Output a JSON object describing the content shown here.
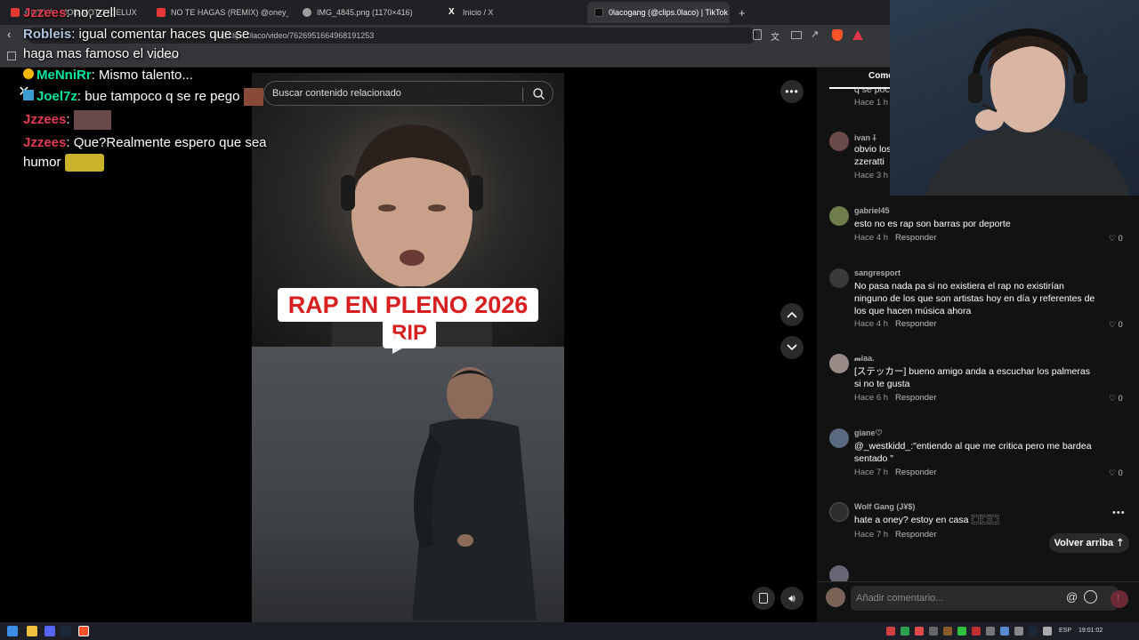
{
  "browser": {
    "tabs": [
      {
        "title": "CIVEVA - MOD MOTO (DELUXE)",
        "color": "#e53935"
      },
      {
        "title": "NO TE HAGAS (REMIX) @oney_fame",
        "color": "#e53935"
      },
      {
        "title": "IMG_4845.png (1170×416)",
        "color": "#9e9e9e"
      },
      {
        "title": "Inicio / X",
        "color": "#ffffff"
      },
      {
        "title": "0lacogang (@clips.0laco) | TikTok",
        "color": "#111111"
      }
    ],
    "new_tab": "+",
    "url": "https://www.tiktok.com/@clips.0laco/video/7626951664968191253",
    "url_visible": "n/@clips.0laco/video/7626951664968191253",
    "bookmark": "ck Stats"
  },
  "chat": [
    {
      "user": "Jzzees",
      "text": ": no, zell",
      "color": "#e53950"
    },
    {
      "user": "Robleis",
      "text": ": igual comentar haces que se haga mas famoso el video",
      "color": "#b0c4de"
    },
    {
      "user": "MeNniRr",
      "text": ": Mismo talento...",
      "color": "#00e6a0"
    },
    {
      "user": "Joel7z",
      "text": ": bue tampoco q se re pego",
      "color": "#00e6a0"
    },
    {
      "user": "Jzzees",
      "text": ":",
      "color": "#e53950"
    },
    {
      "user": "Jzzees",
      "text": ": Que?Realmente espero que sea humor",
      "color": "#e53950"
    }
  ],
  "search": {
    "placeholder": "Buscar contenido relacionado"
  },
  "video": {
    "overlay_title": "RAP EN PLENO 2026",
    "overlay_sub": "RIP"
  },
  "comments_tab": "Come",
  "comments": [
    {
      "user": "",
      "text": "q se pocu",
      "time": "Hace 1 h",
      "reply": "",
      "likes": "",
      "avatar": "#555555"
    },
    {
      "user": "ivan ⸸",
      "text": "obvio los zzeratti",
      "time": "Hace 3 h",
      "reply": "",
      "likes": "",
      "avatar": "#6b4a4a"
    },
    {
      "user": "gabriel45",
      "text": "esto no es rap son barras por deporte",
      "time": "Hace 4 h",
      "reply": "Responder",
      "likes": "0",
      "avatar": "#6e7d4a"
    },
    {
      "user": "sangresport",
      "text": "No pasa nada pa si no existiera el rap no existirían ninguno de los que son artistas hoy en día y referentes de los que hacen música ahora",
      "time": "Hace 4 h",
      "reply": "Responder",
      "likes": "0",
      "avatar": "#3a3a3a"
    },
    {
      "user": "𝓂iaa.",
      "text": "[ステッカー] bueno amigo anda a escuchar los palmeras si no te gusta",
      "time": "Hace 6 h",
      "reply": "Responder",
      "likes": "0",
      "avatar": "#9a8a88"
    },
    {
      "user": "giane♡",
      "text": "@_westkidd_:\"entiendo al que me critica pero me bardea sentado \"",
      "time": "Hace 7 h",
      "reply": "Responder",
      "likes": "0",
      "avatar": "#5a6a80"
    },
    {
      "user": "Wolf Gang (J¥$)",
      "text": "hate a oney? estoy en casa ⿴⿴⿴",
      "time": "Hace 7 h",
      "reply": "Responder",
      "likes": "",
      "avatar": "#2e2e2e"
    }
  ],
  "volver": "Volver arriba ⇡",
  "composer": {
    "placeholder": "Añadir comentario..."
  },
  "taskbar": {
    "lang": "ESP",
    "time": "19:01:02"
  },
  "colors": {
    "accent": "#fe2c55",
    "title_red": "#d81e1e"
  }
}
